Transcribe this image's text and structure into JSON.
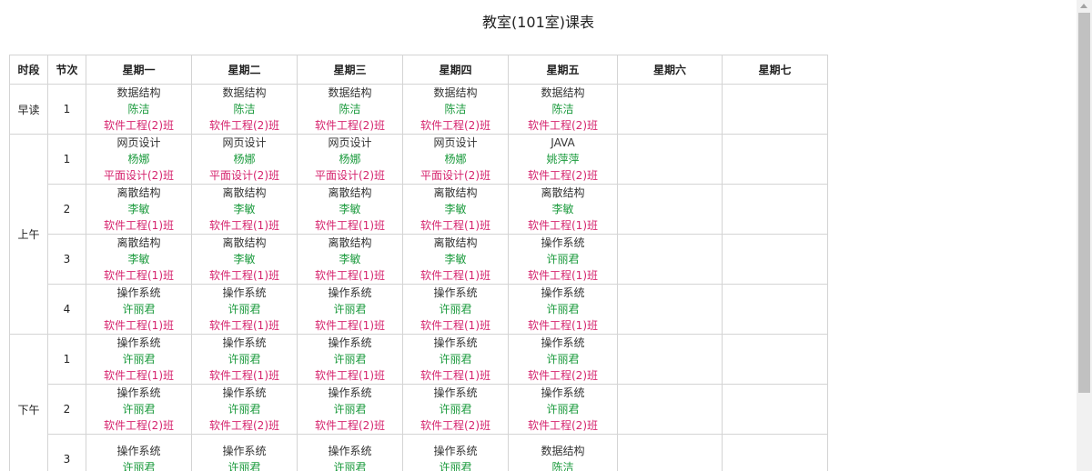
{
  "title": "教室(101室)课表",
  "headers": [
    "时段",
    "节次",
    "星期一",
    "星期二",
    "星期三",
    "星期四",
    "星期五",
    "星期六",
    "星期七"
  ],
  "periods": [
    {
      "label": "早读",
      "slots": [
        {
          "num": "1",
          "days": [
            {
              "subject": "数据结构",
              "teacher": "陈洁",
              "class": "软件工程(2)班"
            },
            {
              "subject": "数据结构",
              "teacher": "陈洁",
              "class": "软件工程(2)班"
            },
            {
              "subject": "数据结构",
              "teacher": "陈洁",
              "class": "软件工程(2)班"
            },
            {
              "subject": "数据结构",
              "teacher": "陈洁",
              "class": "软件工程(2)班"
            },
            {
              "subject": "数据结构",
              "teacher": "陈洁",
              "class": "软件工程(2)班"
            },
            null,
            null
          ]
        }
      ]
    },
    {
      "label": "上午",
      "slots": [
        {
          "num": "1",
          "days": [
            {
              "subject": "网页设计",
              "teacher": "杨娜",
              "class": "平面设计(2)班"
            },
            {
              "subject": "网页设计",
              "teacher": "杨娜",
              "class": "平面设计(2)班"
            },
            {
              "subject": "网页设计",
              "teacher": "杨娜",
              "class": "平面设计(2)班"
            },
            {
              "subject": "网页设计",
              "teacher": "杨娜",
              "class": "平面设计(2)班"
            },
            {
              "subject": "JAVA",
              "teacher": "姚萍萍",
              "class": "软件工程(2)班"
            },
            null,
            null
          ]
        },
        {
          "num": "2",
          "days": [
            {
              "subject": "离散结构",
              "teacher": "李敏",
              "class": "软件工程(1)班"
            },
            {
              "subject": "离散结构",
              "teacher": "李敏",
              "class": "软件工程(1)班"
            },
            {
              "subject": "离散结构",
              "teacher": "李敏",
              "class": "软件工程(1)班"
            },
            {
              "subject": "离散结构",
              "teacher": "李敏",
              "class": "软件工程(1)班"
            },
            {
              "subject": "离散结构",
              "teacher": "李敏",
              "class": "软件工程(1)班"
            },
            null,
            null
          ]
        },
        {
          "num": "3",
          "days": [
            {
              "subject": "离散结构",
              "teacher": "李敏",
              "class": "软件工程(1)班"
            },
            {
              "subject": "离散结构",
              "teacher": "李敏",
              "class": "软件工程(1)班"
            },
            {
              "subject": "离散结构",
              "teacher": "李敏",
              "class": "软件工程(1)班"
            },
            {
              "subject": "离散结构",
              "teacher": "李敏",
              "class": "软件工程(1)班"
            },
            {
              "subject": "操作系统",
              "teacher": "许丽君",
              "class": "软件工程(1)班"
            },
            null,
            null
          ]
        },
        {
          "num": "4",
          "days": [
            {
              "subject": "操作系统",
              "teacher": "许丽君",
              "class": "软件工程(1)班"
            },
            {
              "subject": "操作系统",
              "teacher": "许丽君",
              "class": "软件工程(1)班"
            },
            {
              "subject": "操作系统",
              "teacher": "许丽君",
              "class": "软件工程(1)班"
            },
            {
              "subject": "操作系统",
              "teacher": "许丽君",
              "class": "软件工程(1)班"
            },
            {
              "subject": "操作系统",
              "teacher": "许丽君",
              "class": "软件工程(1)班"
            },
            null,
            null
          ]
        }
      ]
    },
    {
      "label": "下午",
      "slots": [
        {
          "num": "1",
          "days": [
            {
              "subject": "操作系统",
              "teacher": "许丽君",
              "class": "软件工程(1)班"
            },
            {
              "subject": "操作系统",
              "teacher": "许丽君",
              "class": "软件工程(1)班"
            },
            {
              "subject": "操作系统",
              "teacher": "许丽君",
              "class": "软件工程(1)班"
            },
            {
              "subject": "操作系统",
              "teacher": "许丽君",
              "class": "软件工程(1)班"
            },
            {
              "subject": "操作系统",
              "teacher": "许丽君",
              "class": "软件工程(2)班"
            },
            null,
            null
          ]
        },
        {
          "num": "2",
          "days": [
            {
              "subject": "操作系统",
              "teacher": "许丽君",
              "class": "软件工程(2)班"
            },
            {
              "subject": "操作系统",
              "teacher": "许丽君",
              "class": "软件工程(2)班"
            },
            {
              "subject": "操作系统",
              "teacher": "许丽君",
              "class": "软件工程(2)班"
            },
            {
              "subject": "操作系统",
              "teacher": "许丽君",
              "class": "软件工程(2)班"
            },
            {
              "subject": "操作系统",
              "teacher": "许丽君",
              "class": "软件工程(2)班"
            },
            null,
            null
          ]
        },
        {
          "num": "3",
          "days": [
            {
              "subject": "操作系统",
              "teacher": "许丽君",
              "class": ""
            },
            {
              "subject": "操作系统",
              "teacher": "许丽君",
              "class": ""
            },
            {
              "subject": "操作系统",
              "teacher": "许丽君",
              "class": ""
            },
            {
              "subject": "操作系统",
              "teacher": "许丽君",
              "class": ""
            },
            {
              "subject": "数据结构",
              "teacher": "陈洁",
              "class": ""
            },
            null,
            null
          ]
        }
      ]
    }
  ],
  "colors": {
    "teacher": "#1a9a3c",
    "class": "#d6246e",
    "border": "#d4d4d4"
  }
}
